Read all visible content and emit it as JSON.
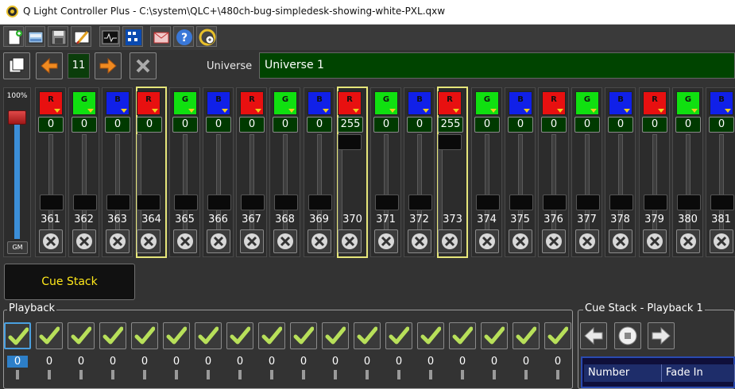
{
  "window": {
    "title": "Q Light Controller Plus - C:\\system\\QLC+\\480ch-bug-simpledesk-showing-white-PXL.qxw"
  },
  "toolbar": {
    "icons": [
      "new-workspace-icon",
      "open-workspace-icon",
      "save-workspace-icon",
      "edit-mode-icon",
      "dmx-monitor-icon",
      "output-enable-icon",
      "blackout-icon",
      "help-icon",
      "fullscreen-icon"
    ]
  },
  "universe_bar": {
    "page": "11",
    "universe_label": "Universe",
    "universe_value": "Universe 1"
  },
  "grand_master": {
    "percent": "100%",
    "button": "GM",
    "level": 1.0
  },
  "channels": [
    {
      "num": "361",
      "color": "R",
      "value": "0",
      "selected": false
    },
    {
      "num": "362",
      "color": "G",
      "value": "0",
      "selected": false
    },
    {
      "num": "363",
      "color": "B",
      "value": "0",
      "selected": false
    },
    {
      "num": "364",
      "color": "R",
      "value": "0",
      "selected": true
    },
    {
      "num": "365",
      "color": "G",
      "value": "0",
      "selected": false
    },
    {
      "num": "366",
      "color": "B",
      "value": "0",
      "selected": false
    },
    {
      "num": "367",
      "color": "R",
      "value": "0",
      "selected": false
    },
    {
      "num": "368",
      "color": "G",
      "value": "0",
      "selected": false
    },
    {
      "num": "369",
      "color": "B",
      "value": "0",
      "selected": false
    },
    {
      "num": "370",
      "color": "R",
      "value": "255",
      "selected": true
    },
    {
      "num": "371",
      "color": "G",
      "value": "0",
      "selected": false
    },
    {
      "num": "372",
      "color": "B",
      "value": "0",
      "selected": false
    },
    {
      "num": "373",
      "color": "R",
      "value": "255",
      "selected": true
    },
    {
      "num": "374",
      "color": "G",
      "value": "0",
      "selected": false
    },
    {
      "num": "375",
      "color": "B",
      "value": "0",
      "selected": false
    },
    {
      "num": "376",
      "color": "R",
      "value": "0",
      "selected": false
    },
    {
      "num": "377",
      "color": "G",
      "value": "0",
      "selected": false
    },
    {
      "num": "378",
      "color": "B",
      "value": "0",
      "selected": false
    },
    {
      "num": "379",
      "color": "R",
      "value": "0",
      "selected": false
    },
    {
      "num": "380",
      "color": "G",
      "value": "0",
      "selected": false
    },
    {
      "num": "381",
      "color": "B",
      "value": "0",
      "selected": false
    }
  ],
  "colors": {
    "R": "#e81010",
    "G": "#10e010",
    "B": "#1020e8",
    "accent": "#e6e67a",
    "value_bg": "#003a00"
  },
  "cue_stack_button": "Cue Stack",
  "playback": {
    "title": "Playback",
    "values": [
      "0",
      "0",
      "0",
      "0",
      "0",
      "0",
      "0",
      "0",
      "0",
      "0",
      "0",
      "0",
      "0",
      "0",
      "0",
      "0",
      "0",
      "0"
    ]
  },
  "cue_stack_panel": {
    "title": "Cue Stack - Playback 1",
    "columns": [
      "Number",
      "Fade In"
    ]
  }
}
